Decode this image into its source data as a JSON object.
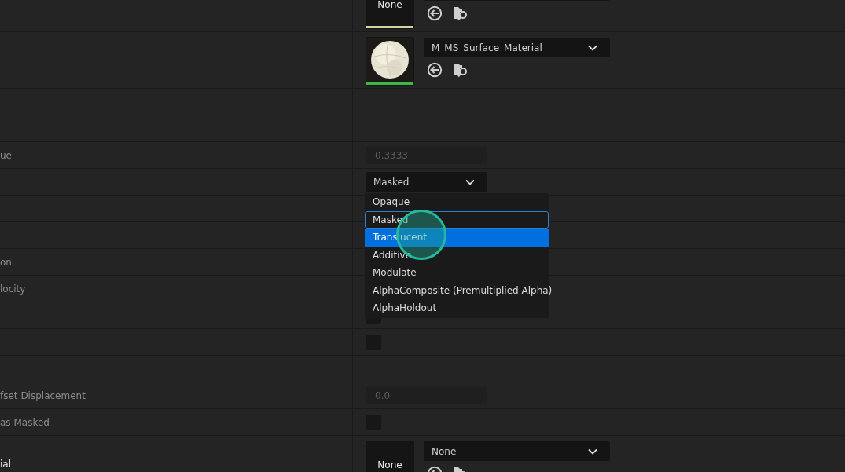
{
  "rows": [
    {
      "kind": "asset",
      "thumb": {
        "kind": "none",
        "label": "None",
        "color": "#d6d2a2"
      }
    },
    {
      "kind": "asset",
      "value": "M_MS_Surface_Material"
    },
    {
      "kind": "empty"
    },
    {
      "kind": "empty"
    },
    {
      "kind": "number",
      "label": "ue",
      "value": "0.3333",
      "disabled": true
    },
    {
      "kind": "combo",
      "value": "Masked"
    },
    {
      "kind": "empty"
    },
    {
      "kind": "empty"
    },
    {
      "kind": "empty",
      "label": "on"
    },
    {
      "kind": "empty",
      "label": "locity"
    },
    {
      "kind": "checkbox",
      "checked": false
    },
    {
      "kind": "checkbox",
      "checked": false
    },
    {
      "kind": "empty"
    },
    {
      "kind": "number",
      "label": "fset Displacement",
      "value": "0.0",
      "disabled": true
    },
    {
      "kind": "checkbox",
      "label": "as Masked",
      "checked": false
    },
    {
      "kind": "asset",
      "label": "ial",
      "bright": true,
      "thumb": {
        "kind": "none",
        "label": "None"
      },
      "value": "None"
    }
  ],
  "menu": {
    "items": [
      {
        "label": "Opaque",
        "selected": false,
        "hovered": false
      },
      {
        "label": "Masked",
        "selected": false,
        "hovered": true
      },
      {
        "label": "Translucent",
        "selected": true,
        "hovered": false
      },
      {
        "label": "Additive",
        "selected": false,
        "hovered": false
      },
      {
        "label": "Modulate",
        "selected": false,
        "hovered": false
      },
      {
        "label": "AlphaComposite (Premultiplied Alpha)",
        "selected": false,
        "hovered": false
      },
      {
        "label": "AlphaHoldout",
        "selected": false,
        "hovered": false
      }
    ]
  }
}
